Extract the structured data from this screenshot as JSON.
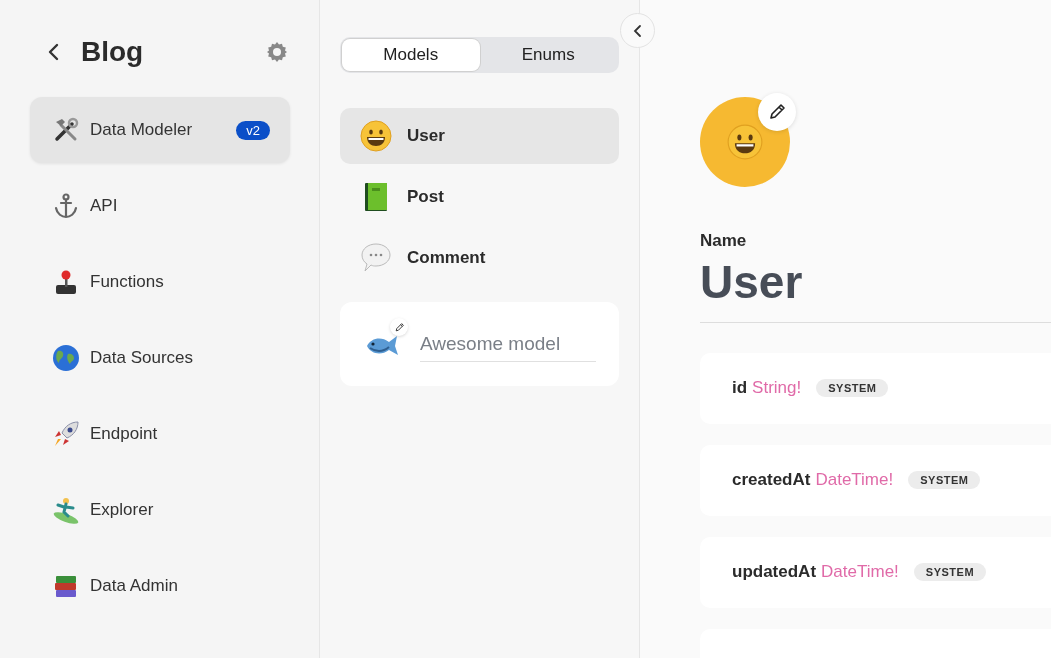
{
  "sidebar": {
    "title": "Blog",
    "items": [
      {
        "label": "Data Modeler",
        "badge": "v2",
        "selected": true
      },
      {
        "label": "API",
        "selected": false
      },
      {
        "label": "Functions",
        "selected": false
      },
      {
        "label": "Data Sources",
        "selected": false
      },
      {
        "label": "Endpoint",
        "selected": false
      },
      {
        "label": "Explorer",
        "selected": false
      },
      {
        "label": "Data Admin",
        "selected": false
      }
    ]
  },
  "tabs": [
    {
      "label": "Models",
      "selected": true
    },
    {
      "label": "Enums",
      "selected": false
    }
  ],
  "models": [
    {
      "name": "User",
      "selected": true
    },
    {
      "name": "Post",
      "selected": false
    },
    {
      "name": "Comment",
      "selected": false
    }
  ],
  "new_model": {
    "placeholder": "Awesome model"
  },
  "detail": {
    "name_label": "Name",
    "name": "User",
    "fields": [
      {
        "name": "id",
        "type": "String!",
        "badge": "SYSTEM"
      },
      {
        "name": "createdAt",
        "type": "DateTime!",
        "badge": "SYSTEM"
      },
      {
        "name": "updatedAt",
        "type": "DateTime!",
        "badge": "SYSTEM"
      }
    ]
  }
}
